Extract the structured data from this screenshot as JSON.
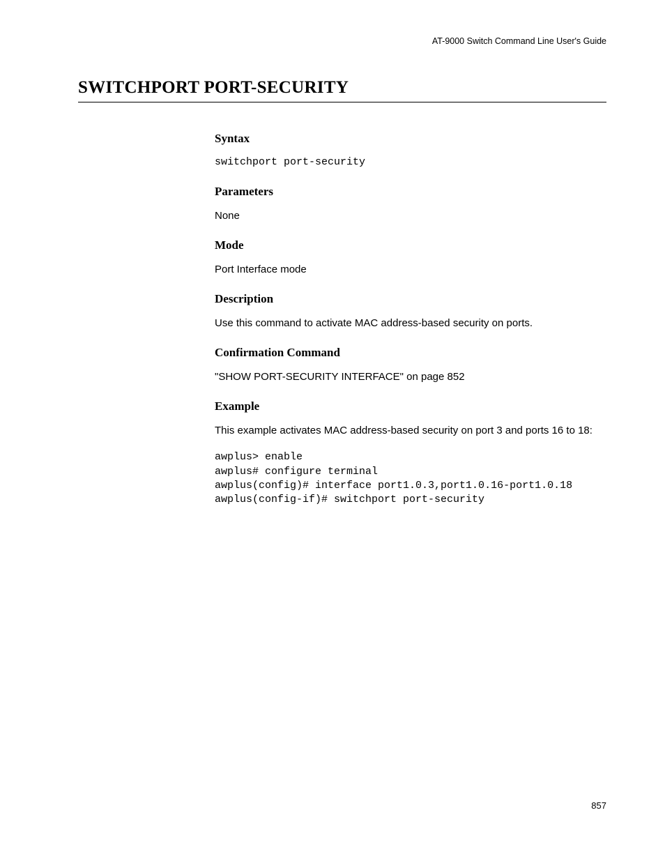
{
  "running_head": "AT-9000 Switch Command Line User's Guide",
  "title": "SWITCHPORT PORT-SECURITY",
  "sections": {
    "syntax": {
      "heading": "Syntax",
      "code": "switchport port-security"
    },
    "parameters": {
      "heading": "Parameters",
      "body": "None"
    },
    "mode": {
      "heading": "Mode",
      "body": "Port Interface mode"
    },
    "description": {
      "heading": "Description",
      "body": "Use this command to activate MAC address-based security on ports."
    },
    "confirmation": {
      "heading": "Confirmation Command",
      "body": "\"SHOW PORT-SECURITY INTERFACE\" on page 852"
    },
    "example": {
      "heading": "Example",
      "intro": "This example activates MAC address-based security on port 3 and ports 16 to 18:",
      "code": "awplus> enable\nawplus# configure terminal\nawplus(config)# interface port1.0.3,port1.0.16-port1.0.18\nawplus(config-if)# switchport port-security"
    }
  },
  "page_number": "857"
}
